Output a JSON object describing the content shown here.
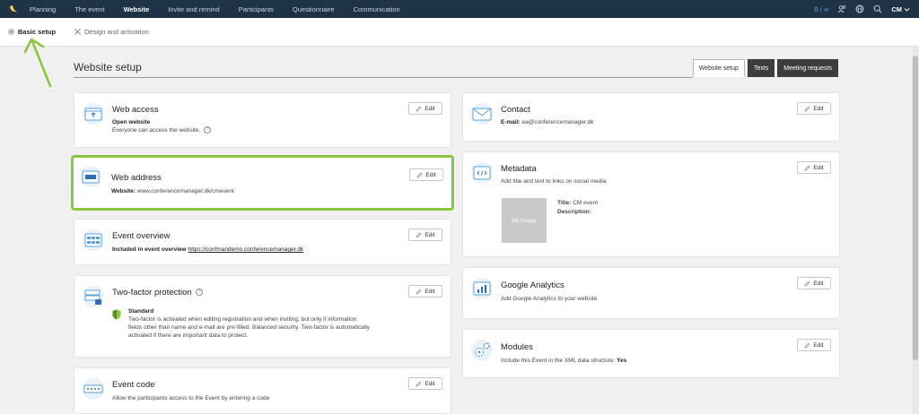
{
  "nav": {
    "items": [
      "Planning",
      "The event",
      "Website",
      "Invite and remind",
      "Participants",
      "Questionnaire",
      "Communication"
    ],
    "active_index": 2,
    "count": "0 / ∞",
    "user": "CM"
  },
  "subnav": {
    "items": [
      "Basic setup",
      "Design and activation"
    ],
    "active_index": 0
  },
  "header": {
    "title": "Website setup",
    "tabs": [
      "Website setup",
      "Texts",
      "Meeting requests"
    ]
  },
  "edit_label": "Edit",
  "cards": {
    "web_access": {
      "title": "Web access",
      "line1": "Open website",
      "line2": "Everyone can access the website."
    },
    "web_address": {
      "title": "Web address",
      "label": "Website:",
      "value": "www.conferencemanager.dk/cmevent"
    },
    "event_overview": {
      "title": "Event overview",
      "label": "Included in event overview",
      "link": "https://confmandemo.conferencemanager.dk"
    },
    "two_factor": {
      "title": "Two-factor protection",
      "level": "Standard",
      "desc1": "Two-factor is activated when editing registration and when inviting, but only if information",
      "desc2": "fields other than name and e-mail are pre-filled. Balanced security. Two-factor is automatically",
      "desc3": "activated if there are important data to protect."
    },
    "event_code": {
      "title": "Event code",
      "desc": "Allow the participants access to the Event by entering a code"
    },
    "contact": {
      "title": "Contact",
      "label": "E-mail:",
      "value": "ea@conferencemanager.dk"
    },
    "metadata": {
      "title": "Metadata",
      "desc": "Add title and text to links on social media",
      "no_image": "No image",
      "title_label": "Title:",
      "title_value": "CM event",
      "description_label": "Description:"
    },
    "google_analytics": {
      "title": "Google Analytics",
      "desc": "Add Google Analytics to your website"
    },
    "modules": {
      "title": "Modules",
      "desc": "Include this Event in the XML data structure:",
      "value": "Yes"
    }
  },
  "colors": {
    "nav_bg": "#1f3347",
    "highlight": "#8cc63f",
    "icon_blue": "#5aa0d8"
  }
}
